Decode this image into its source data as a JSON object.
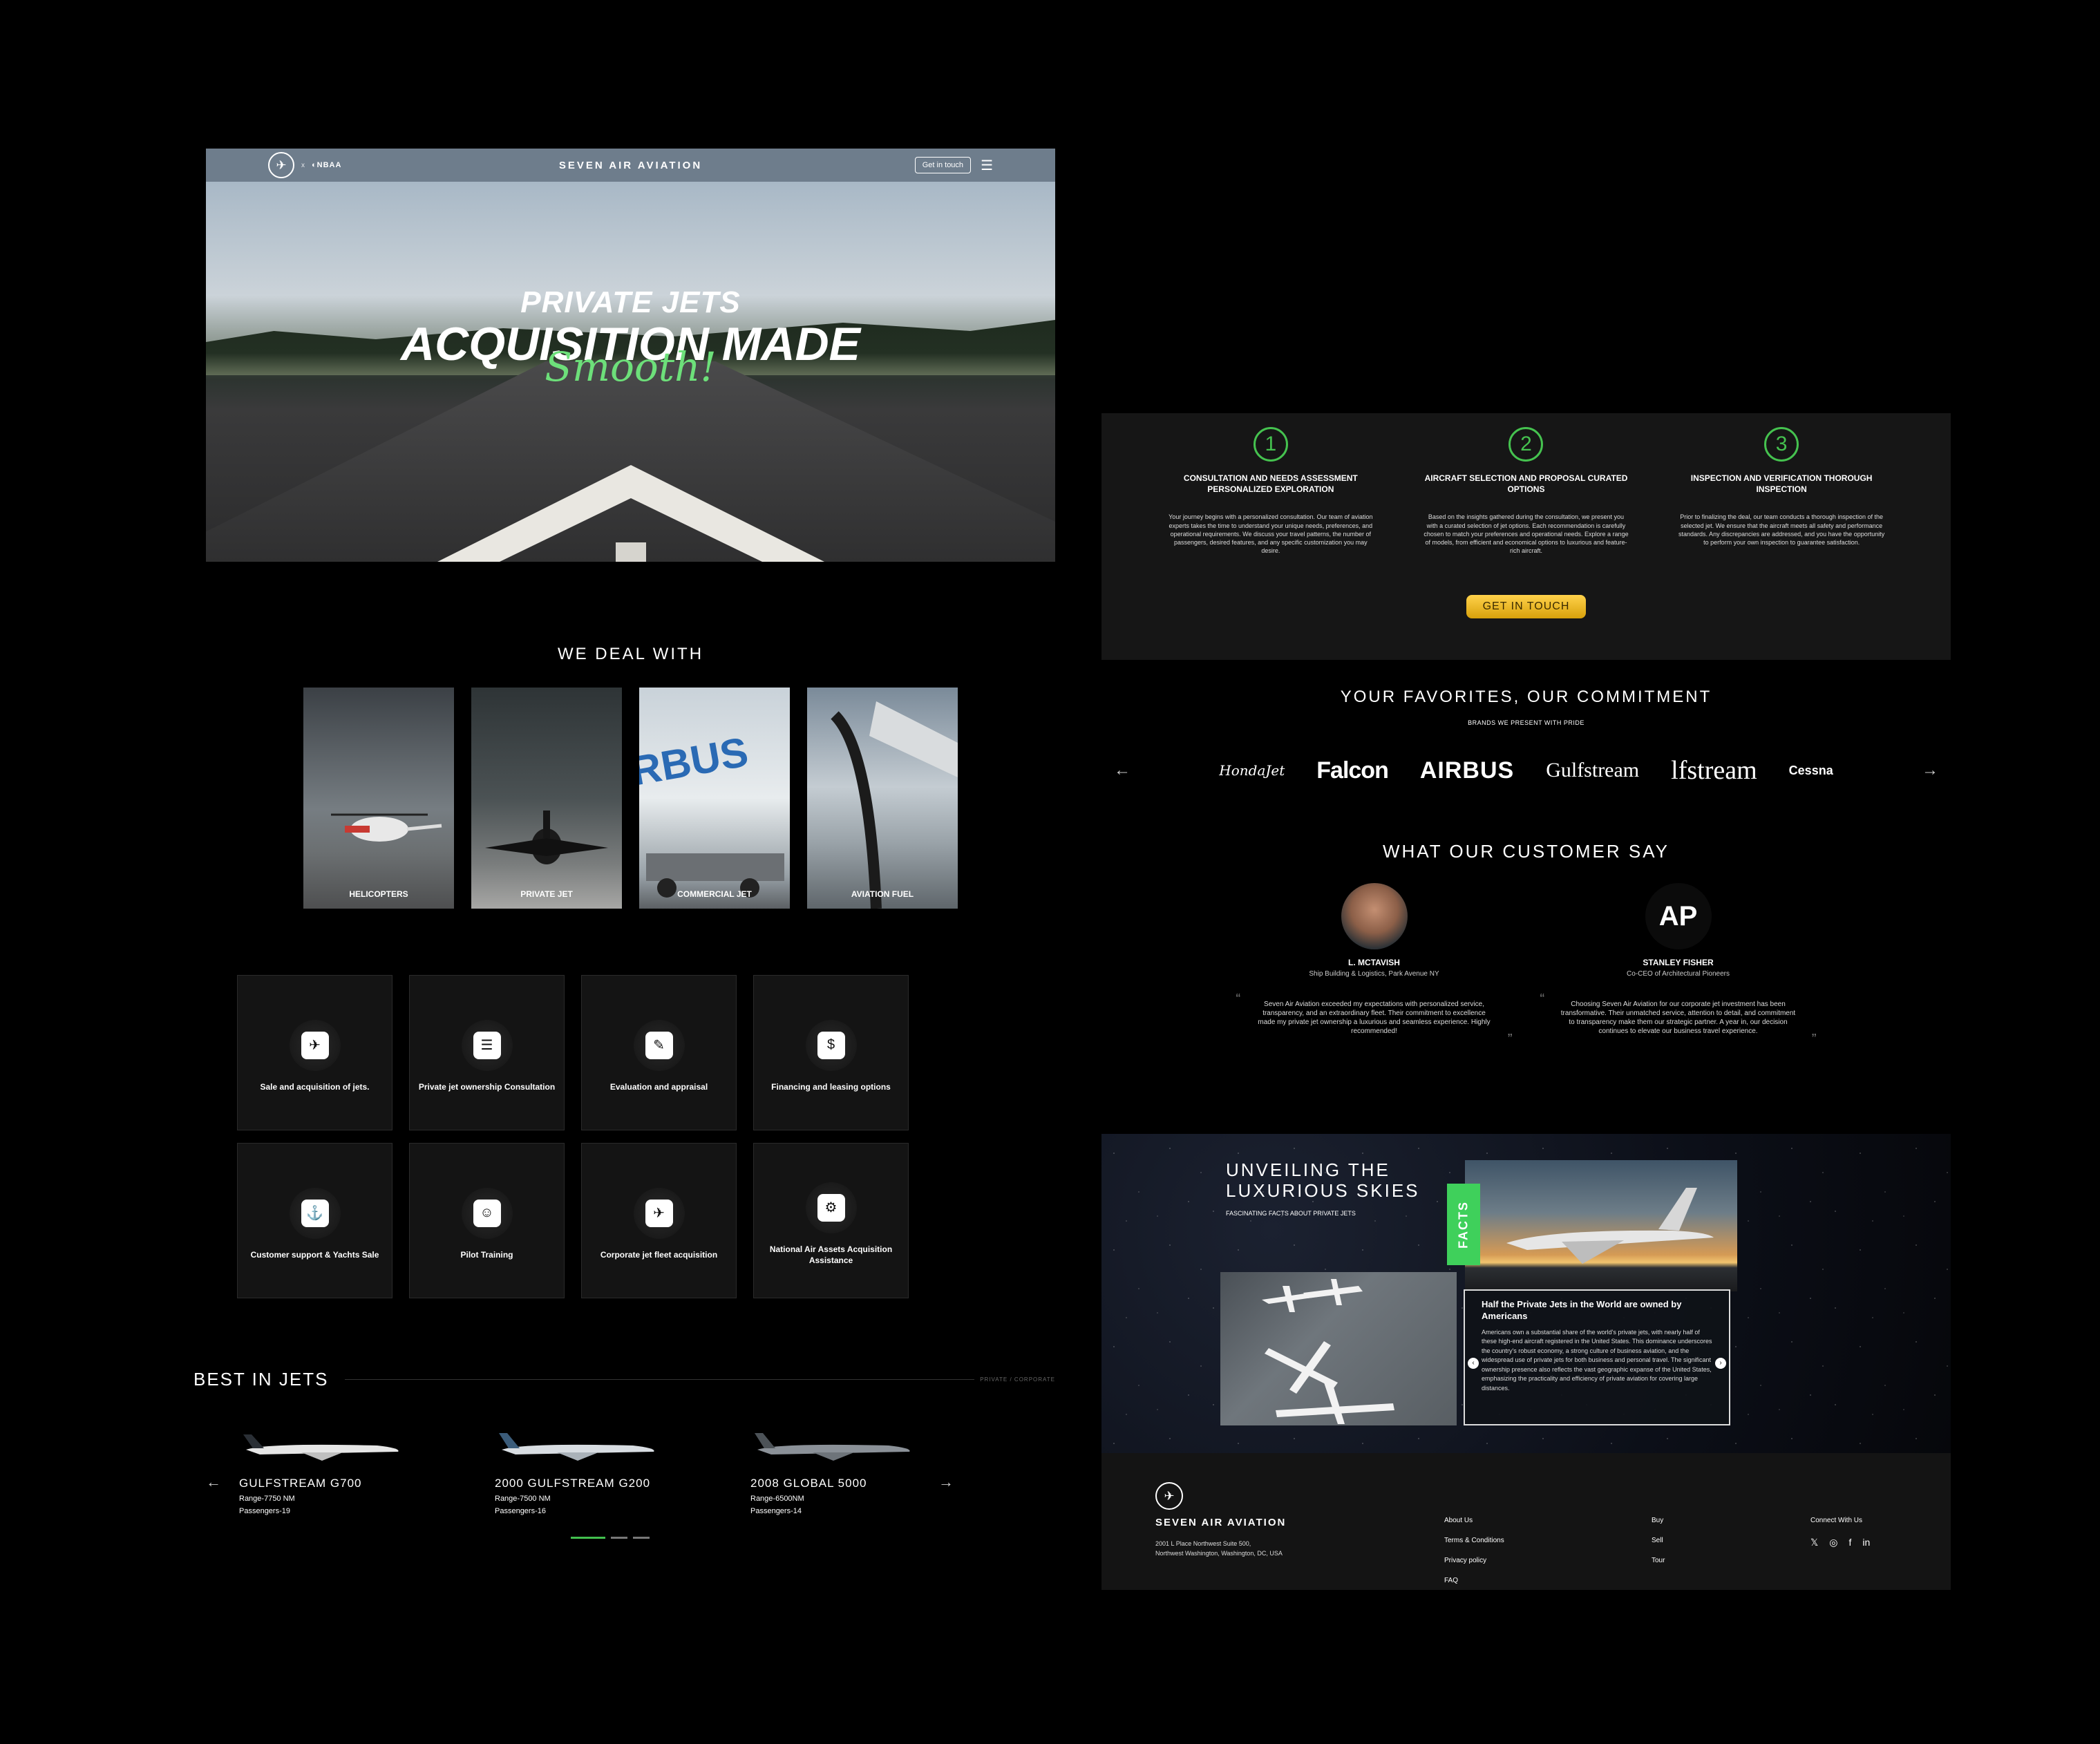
{
  "header": {
    "logo_symbol": "✈",
    "partner_sep": "x",
    "partner_logo": "◐NBAA",
    "site_title": "SEVEN AIR AVIATION",
    "cta_label": "Get in touch",
    "menu_icon": "☰"
  },
  "hero": {
    "line1": "PRIVATE JETS",
    "line2": "ACQUISITION MADE",
    "line3": "Smooth!"
  },
  "deal": {
    "title": "WE DEAL WITH",
    "items": [
      {
        "label": "HELICOPTERS"
      },
      {
        "label": "PRIVATE JET"
      },
      {
        "label": "COMMERCIAL JET"
      },
      {
        "label": "AVIATION FUEL"
      }
    ]
  },
  "services": [
    {
      "label": "Sale and acquisition of jets.",
      "icon": "plane-tag-icon",
      "glyph": "✈"
    },
    {
      "label": "Private jet ownership Consultation",
      "icon": "consultation-icon",
      "glyph": "☰"
    },
    {
      "label": "Evaluation and appraisal",
      "icon": "appraisal-icon",
      "glyph": "✎"
    },
    {
      "label": "Financing and leasing options",
      "icon": "finance-icon",
      "glyph": "$"
    },
    {
      "label": "Customer support & Yachts Sale",
      "icon": "support-icon",
      "glyph": "⚓"
    },
    {
      "label": "Pilot Training",
      "icon": "pilot-icon",
      "glyph": "☺"
    },
    {
      "label": "Corporate jet fleet acquisition",
      "icon": "fleet-icon",
      "glyph": "✈"
    },
    {
      "label": "National Air Assets Acquisition Assistance",
      "icon": "assets-icon",
      "glyph": "⚙"
    }
  ],
  "best": {
    "title": "BEST IN JETS",
    "category": "PRIVATE / CORPORATE",
    "jets": [
      {
        "name": "GULFSTREAM G700",
        "range": "Range-7750 NM",
        "passengers": "Passengers-19"
      },
      {
        "name": "2000 GULFSTREAM G200",
        "range": "Range-7500 NM",
        "passengers": "Passengers-16"
      },
      {
        "name": "2008 GLOBAL 5000",
        "range": "Range-6500NM",
        "passengers": "Passengers-14"
      }
    ],
    "prev": "←",
    "next": "→"
  },
  "process": {
    "steps": [
      {
        "num": "1",
        "heading": "CONSULTATION AND NEEDS ASSESSMENT PERSONALIZED EXPLORATION",
        "text": "Your journey begins with a personalized consultation. Our team of aviation experts takes the time to understand your unique needs, preferences, and operational requirements. We discuss your travel patterns, the number of passengers, desired features, and any specific customization you may desire."
      },
      {
        "num": "2",
        "heading": "AIRCRAFT SELECTION AND PROPOSAL CURATED OPTIONS",
        "text": "Based on the insights gathered during the consultation, we present you with a curated selection of jet options. Each recommendation is carefully chosen to match your preferences and operational needs. Explore a range of models, from efficient and economical options to luxurious and feature-rich aircraft."
      },
      {
        "num": "3",
        "heading": "INSPECTION AND VERIFICATION THOROUGH INSPECTION",
        "text": "Prior to finalizing the deal, our team conducts a thorough inspection of the selected jet. We ensure that the aircraft meets all safety and performance standards. Any discrepancies are addressed, and you have the opportunity to perform your own inspection to guarantee satisfaction."
      }
    ],
    "cta": "GET IN TOUCH"
  },
  "favorites": {
    "title": "YOUR FAVORITES, OUR COMMITMENT",
    "subtitle": "BRANDS WE PRESENT WITH PRIDE",
    "brands": [
      "HondaJet",
      "Falcon",
      "AIRBUS",
      "Gulfstream",
      "lfstream",
      "Cessna"
    ],
    "prev": "←",
    "next": "→"
  },
  "customers": {
    "title": "WHAT OUR CUSTOMER SAY",
    "items": [
      {
        "initials": "",
        "name": "L. MCTAVISH",
        "role": "Ship Building & Logistics, Park Avenue NY",
        "quote": "Seven Air Aviation exceeded my expectations with personalized service, transparency, and an extraordinary fleet. Their commitment to excellence made my private jet ownership a luxurious and seamless experience. Highly recommended!"
      },
      {
        "initials": "AP",
        "name": "STANLEY FISHER",
        "role": "Co-CEO of Architectural Pioneers",
        "quote": "Choosing Seven Air Aviation for our corporate jet investment has been transformative. Their unmatched service, attention to detail, and commitment to transparency make them our strategic partner. A year in, our decision continues to elevate our business travel experience."
      }
    ]
  },
  "facts": {
    "title_l1": "UNVEILING THE",
    "title_l2": "LUXURIOUS SKIES",
    "subtitle": "FASCINATING FACTS ABOUT PRIVATE JETS",
    "badge": "FACTS",
    "card_title": "Half the Private Jets in the World are owned by Americans",
    "card_text": "Americans own a substantial share of the world's private jets, with nearly half of these high-end aircraft registered in the United States. This dominance underscores the country's robust economy, a strong culture of business aviation, and the widespread use of private jets for both business and personal travel. The significant ownership presence also reflects the vast geographic expanse of the United States, emphasizing the practicality and efficiency of private aviation for covering large distances.",
    "prev": "‹",
    "next": "›"
  },
  "footer": {
    "logo_symbol": "✈",
    "name": "SEVEN AIR AVIATION",
    "address_l1": "2001 L Place Northwest Suite 500,",
    "address_l2": "Northwest Washington, Washington, DC, USA",
    "links1": [
      "About Us",
      "Terms & Conditions",
      "Privacy policy",
      "FAQ"
    ],
    "links2": [
      "Buy",
      "Sell",
      "Tour"
    ],
    "connect": "Connect With Us",
    "social": [
      "𝕏",
      "◎",
      "f",
      "in"
    ]
  }
}
